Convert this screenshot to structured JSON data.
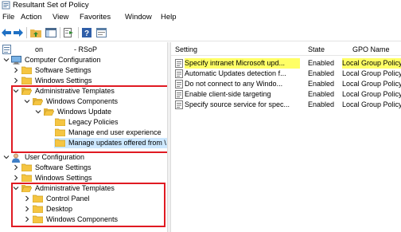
{
  "window": {
    "title": "Resultant Set of Policy"
  },
  "menu": {
    "items": [
      "File",
      "Action",
      "View",
      "Favorites",
      "Window",
      "Help"
    ]
  },
  "toolbar": {
    "buttons": [
      "back-arrow-icon",
      "forward-arrow-icon",
      "up-folder-icon",
      "show-hide-tree-icon",
      "export-list-icon",
      "help-icon",
      "properties-icon"
    ]
  },
  "tree": {
    "root": {
      "label_prefix": "",
      "label_mid": "on",
      "label_suffix": "- RSoP"
    },
    "items": [
      {
        "label": "Computer Configuration",
        "state": "expanded"
      },
      {
        "label": "Software Settings",
        "state": "collapsed"
      },
      {
        "label": "Windows Settings",
        "state": "collapsed"
      },
      {
        "label": "Administrative Templates",
        "state": "expanded"
      },
      {
        "label": "Windows Components",
        "state": "expanded"
      },
      {
        "label": "Windows Update",
        "state": "expanded"
      },
      {
        "label": "Legacy Policies",
        "state": "leaf"
      },
      {
        "label": "Manage end user experience",
        "state": "leaf"
      },
      {
        "label": "Manage updates offered from \\",
        "state": "leaf",
        "selected": true
      },
      {
        "label": "User Configuration",
        "state": "expanded"
      },
      {
        "label": "Software Settings",
        "state": "collapsed"
      },
      {
        "label": "Windows Settings",
        "state": "collapsed"
      },
      {
        "label": "Administrative Templates",
        "state": "expanded"
      },
      {
        "label": "Control Panel",
        "state": "collapsed"
      },
      {
        "label": "Desktop",
        "state": "collapsed"
      },
      {
        "label": "Windows Components",
        "state": "collapsed"
      }
    ]
  },
  "list": {
    "columns": [
      "Setting",
      "State",
      "GPO Name"
    ],
    "rows": [
      {
        "setting": "Specify intranet Microsoft upd...",
        "state": "Enabled",
        "gpo": "Local Group Policy",
        "highlight": true
      },
      {
        "setting": "Automatic Updates detection f...",
        "state": "Enabled",
        "gpo": "Local Group Policy",
        "highlight": false
      },
      {
        "setting": "Do not connect to any Windo...",
        "state": "Enabled",
        "gpo": "Local Group Policy",
        "highlight": false
      },
      {
        "setting": "Enable client-side targeting",
        "state": "Enabled",
        "gpo": "Local Group Policy",
        "highlight": false
      },
      {
        "setting": "Specify source service for spec...",
        "state": "Enabled",
        "gpo": "Local Group Policy",
        "highlight": false
      }
    ]
  },
  "colors": {
    "highlight_box": "#e01a22",
    "selection": "#cde8ff",
    "text_highlight": "#ffff66",
    "folder": "#f5c542"
  }
}
